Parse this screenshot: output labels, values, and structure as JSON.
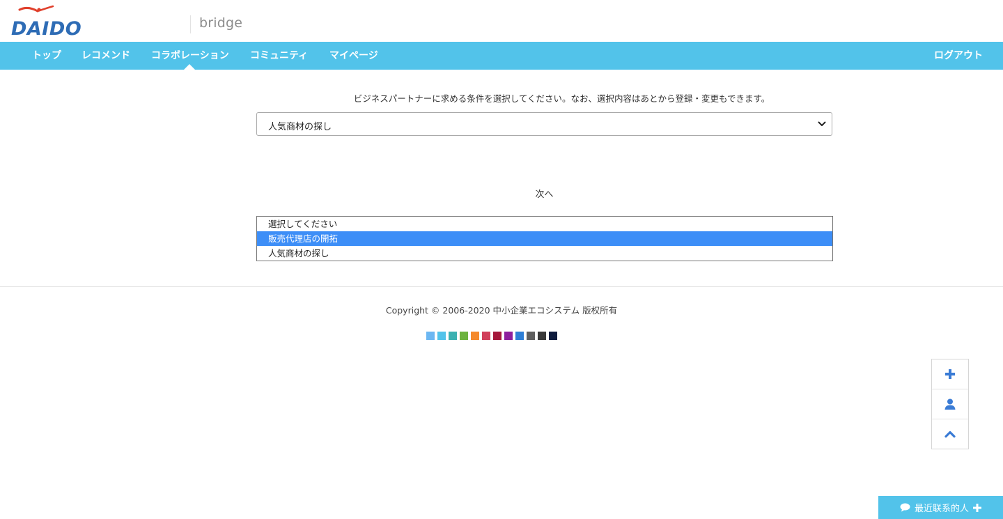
{
  "header": {
    "logo_text": "DAIDO",
    "brand": "bridge"
  },
  "nav": {
    "items": [
      {
        "label": "トップ"
      },
      {
        "label": "レコメンド"
      },
      {
        "label": "コラボレーション"
      },
      {
        "label": "コミュニティ"
      },
      {
        "label": "マイページ"
      }
    ],
    "active": "コラボレーション",
    "logout": "ログアウト"
  },
  "main": {
    "intro": "ビジネスパートナーに求める条件を選択してください。なお、選択内容はあとから登録・変更もできます。",
    "select_value": "人気商材の探し",
    "next": "次へ",
    "options": [
      {
        "label": "選択してください",
        "selected": false
      },
      {
        "label": "販売代理店の開拓",
        "selected": true
      },
      {
        "label": "人気商材の探し",
        "selected": false
      }
    ]
  },
  "footer": {
    "copyright": "Copyright © 2006-2020 中小企業エコシステム 版权所有",
    "theme_colors": [
      "#6cb7f2",
      "#52c3ea",
      "#3bb1b1",
      "#6db33f",
      "#f58a2c",
      "#d13f5a",
      "#a5173a",
      "#8e1f9e",
      "#2d7ed6",
      "#5f5f5f",
      "#3a3a3a",
      "#0e1b3d"
    ]
  },
  "side_tools": {
    "icons": [
      "plus-icon",
      "user-icon",
      "chevron-up-icon"
    ]
  },
  "contact_bar": {
    "label": "最近联系的人",
    "icon": "chat-bubble-icon",
    "accent": "#52c3ea"
  }
}
